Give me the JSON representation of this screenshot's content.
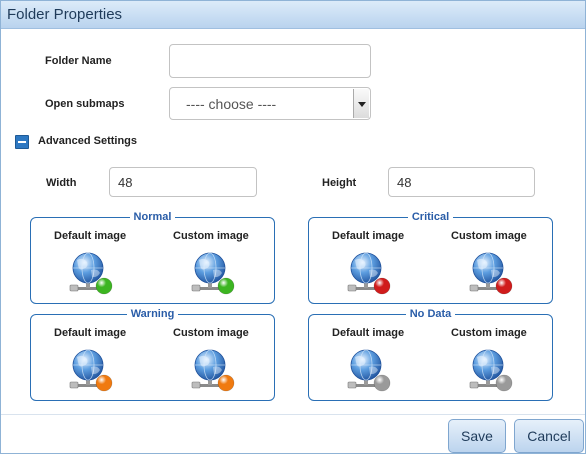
{
  "dialog": {
    "title": "Folder Properties"
  },
  "form": {
    "folder_name_label": "Folder Name",
    "folder_name_value": "",
    "submaps_label": "Open submaps",
    "submaps_selected": "---- choose ----",
    "advanced_label": "Advanced Settings",
    "width_label": "Width",
    "width_value": "48",
    "height_label": "Height",
    "height_value": "48"
  },
  "groups": [
    {
      "title": "Normal",
      "default_label": "Default image",
      "custom_label": "Custom image",
      "color": "#3cb521"
    },
    {
      "title": "Critical",
      "default_label": "Default image",
      "custom_label": "Custom image",
      "color": "#d01c1c"
    },
    {
      "title": "Warning",
      "default_label": "Default image",
      "custom_label": "Custom image",
      "color": "#f07a10"
    },
    {
      "title": "No Data",
      "default_label": "Default image",
      "custom_label": "Custom image",
      "color": "#9a9a9a"
    }
  ],
  "footer": {
    "save_label": "Save",
    "cancel_label": "Cancel"
  }
}
